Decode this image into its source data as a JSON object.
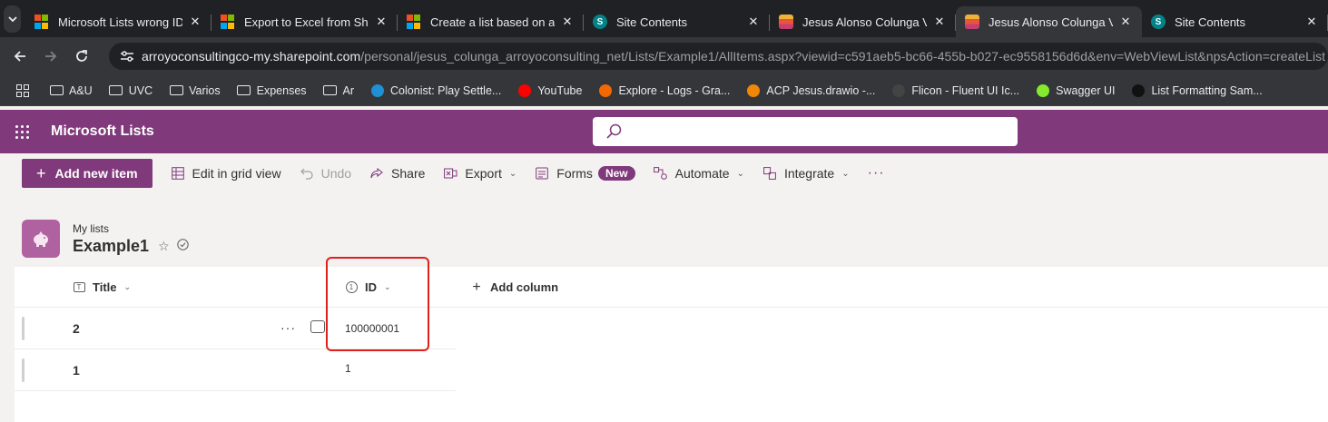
{
  "browser": {
    "tabs": [
      {
        "title": "Microsoft Lists wrong ID v",
        "icon": "microsoft-icon",
        "active": false
      },
      {
        "title": "Export to Excel from Share",
        "icon": "microsoft-icon",
        "active": false
      },
      {
        "title": "Create a list based on a sp",
        "icon": "microsoft-icon",
        "active": false
      },
      {
        "title": "Site Contents",
        "icon": "sharepoint-icon",
        "active": false
      },
      {
        "title": "Jesus Alonso Colunga Villa",
        "icon": "stack-icon",
        "active": false
      },
      {
        "title": "Jesus Alonso Colunga Villa",
        "icon": "stack-icon",
        "active": true
      },
      {
        "title": "Site Contents",
        "icon": "sharepoint-icon",
        "active": false
      }
    ],
    "url_host": "arroyoconsultingco-my.sharepoint.com",
    "url_path": "/personal/jesus_colunga_arroyoconsulting_net/Lists/Example1/AllItems.aspx?viewid=c591aeb5-bc66-455b-b027-ec9558156d6d&env=WebViewList&npsAction=createList",
    "bookmarks": [
      {
        "label": "A&U",
        "icon": "folder-icon"
      },
      {
        "label": "UVC",
        "icon": "folder-icon"
      },
      {
        "label": "Varios",
        "icon": "folder-icon"
      },
      {
        "label": "Expenses",
        "icon": "folder-icon"
      },
      {
        "label": "Ar",
        "icon": "folder-icon"
      },
      {
        "label": "Colonist: Play Settle...",
        "icon": "colonist-icon"
      },
      {
        "label": "YouTube",
        "icon": "youtube-icon"
      },
      {
        "label": "Explore - Logs - Gra...",
        "icon": "grafana-icon"
      },
      {
        "label": "ACP Jesus.drawio -...",
        "icon": "drawio-icon"
      },
      {
        "label": "Flicon - Fluent UI Ic...",
        "icon": "flicon-icon"
      },
      {
        "label": "Swagger UI",
        "icon": "swagger-icon"
      },
      {
        "label": "List Formatting Sam...",
        "icon": "github-icon"
      }
    ]
  },
  "app": {
    "name": "Microsoft Lists",
    "accent": "#80397b"
  },
  "toolbar": {
    "new_item": "Add new item",
    "edit_grid": "Edit in grid view",
    "undo": "Undo",
    "share": "Share",
    "export": "Export",
    "forms": "Forms",
    "forms_badge": "New",
    "automate": "Automate",
    "integrate": "Integrate",
    "more": "···"
  },
  "list": {
    "breadcrumb": "My lists",
    "title": "Example1",
    "columns": {
      "title": "Title",
      "id": "ID",
      "add": "Add column"
    },
    "rows": [
      {
        "title": "2",
        "id": "100000001"
      },
      {
        "title": "1",
        "id": "1"
      }
    ],
    "row_more": "···"
  }
}
